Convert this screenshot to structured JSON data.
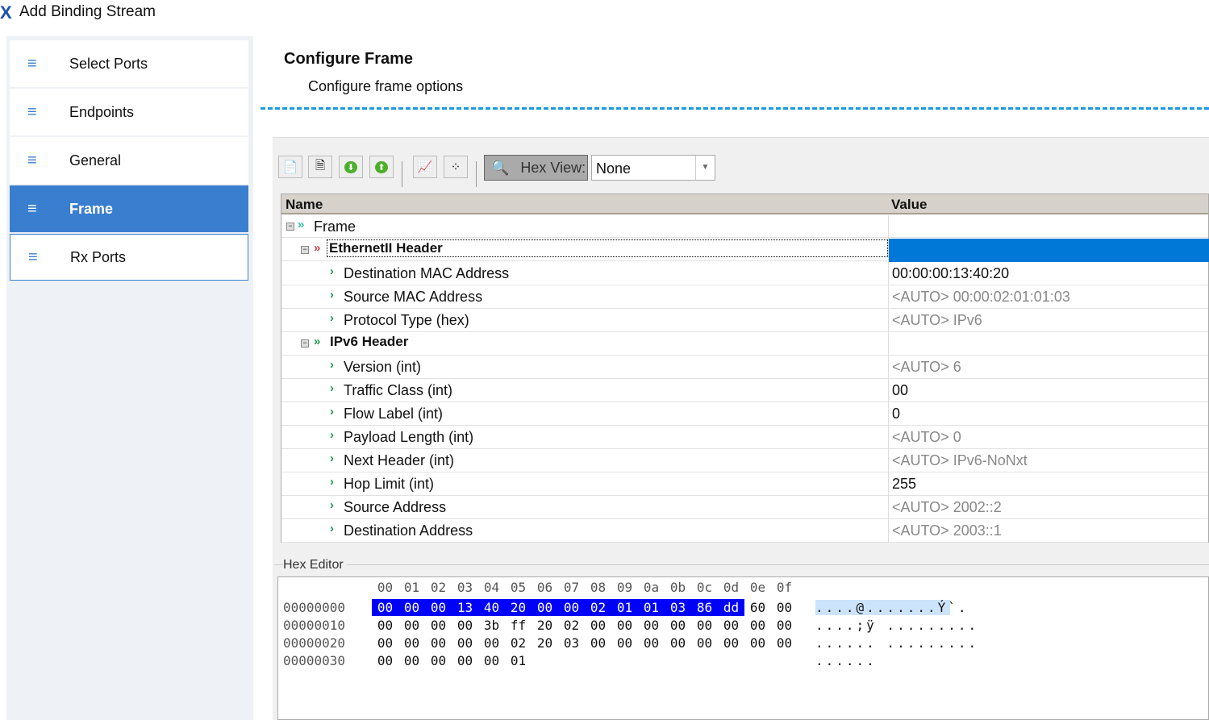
{
  "window": {
    "title": "Add Binding Stream",
    "logo": "X"
  },
  "sidebar": {
    "items": [
      {
        "label": "Select Ports",
        "icon": "menu-icon"
      },
      {
        "label": "Endpoints",
        "icon": "menu-icon"
      },
      {
        "label": "General",
        "icon": "menu-icon"
      },
      {
        "label": "Frame",
        "icon": "menu-icon",
        "selected": true
      },
      {
        "label": "Rx Ports",
        "icon": "menu-icon"
      }
    ]
  },
  "header": {
    "title": "Configure Frame",
    "subtitle": "Configure frame options"
  },
  "toolbar": {
    "hex_view_label": "Hex View:",
    "hex_view_value": "None",
    "buttons": [
      "add-field-icon",
      "delete-field-icon",
      "move-down-icon",
      "move-up-icon",
      "chart-icon",
      "nodes-icon"
    ]
  },
  "grid": {
    "columns": [
      "Name",
      "Value"
    ],
    "rows": [
      {
        "name": "Frame",
        "level": 0,
        "type": "group",
        "value": ""
      },
      {
        "name": "EthernetII Header",
        "level": 1,
        "type": "header",
        "value": "",
        "selected": true
      },
      {
        "name": "Destination MAC Address",
        "level": 2,
        "value": "00:00:00:13:40:20",
        "auto": false
      },
      {
        "name": "Source MAC Address",
        "level": 2,
        "value": "<AUTO> 00:00:02:01:01:03",
        "auto": true
      },
      {
        "name": "Protocol Type (hex)",
        "level": 2,
        "value": "<AUTO> IPv6",
        "auto": true
      },
      {
        "name": "IPv6 Header",
        "level": 1,
        "type": "header",
        "value": ""
      },
      {
        "name": "Version  (int)",
        "level": 2,
        "value": "<AUTO> 6",
        "auto": true
      },
      {
        "name": "Traffic Class (int)",
        "level": 2,
        "value": "00",
        "auto": false
      },
      {
        "name": "Flow Label (int)",
        "level": 2,
        "value": "0",
        "auto": false
      },
      {
        "name": "Payload Length (int)",
        "level": 2,
        "value": "<AUTO> 0",
        "auto": true
      },
      {
        "name": "Next Header (int)",
        "level": 2,
        "value": "<AUTO> IPv6-NoNxt",
        "auto": true
      },
      {
        "name": "Hop Limit (int)",
        "level": 2,
        "value": "255",
        "auto": false
      },
      {
        "name": "Source Address",
        "level": 2,
        "value": "<AUTO> 2002::2",
        "auto": true
      },
      {
        "name": "Destination Address",
        "level": 2,
        "value": "<AUTO> 2003::1",
        "auto": true
      }
    ]
  },
  "hex_editor": {
    "label": "Hex Editor",
    "columns": [
      "00",
      "01",
      "02",
      "03",
      "04",
      "05",
      "06",
      "07",
      "08",
      "09",
      "0a",
      "0b",
      "0c",
      "0d",
      "0e",
      "0f"
    ],
    "rows": [
      {
        "offset": "00000000",
        "bytes": [
          "00",
          "00",
          "00",
          "13",
          "40",
          "20",
          "00",
          "00",
          "02",
          "01",
          "01",
          "03",
          "86",
          "dd",
          "60",
          "00"
        ],
        "ascii": "....@.......Ý`."
      },
      {
        "offset": "00000010",
        "bytes": [
          "00",
          "00",
          "00",
          "00",
          "3b",
          "ff",
          "20",
          "02",
          "00",
          "00",
          "00",
          "00",
          "00",
          "00",
          "00",
          "00"
        ],
        "ascii": "....;ÿ ........."
      },
      {
        "offset": "00000020",
        "bytes": [
          "00",
          "00",
          "00",
          "00",
          "00",
          "02",
          "20",
          "03",
          "00",
          "00",
          "00",
          "00",
          "00",
          "00",
          "00",
          "00"
        ],
        "ascii": "...... ........."
      },
      {
        "offset": "00000030",
        "bytes": [
          "00",
          "00",
          "00",
          "00",
          "00",
          "01"
        ],
        "ascii": "......"
      }
    ],
    "selected_bytes": 14,
    "selection_color": "#0000ff",
    "ascii_selection_color": "#cce4fb"
  },
  "colors": {
    "accent": "#3a7fcf",
    "selected_row": "#0078d7",
    "dash": "#1a9ae0"
  }
}
